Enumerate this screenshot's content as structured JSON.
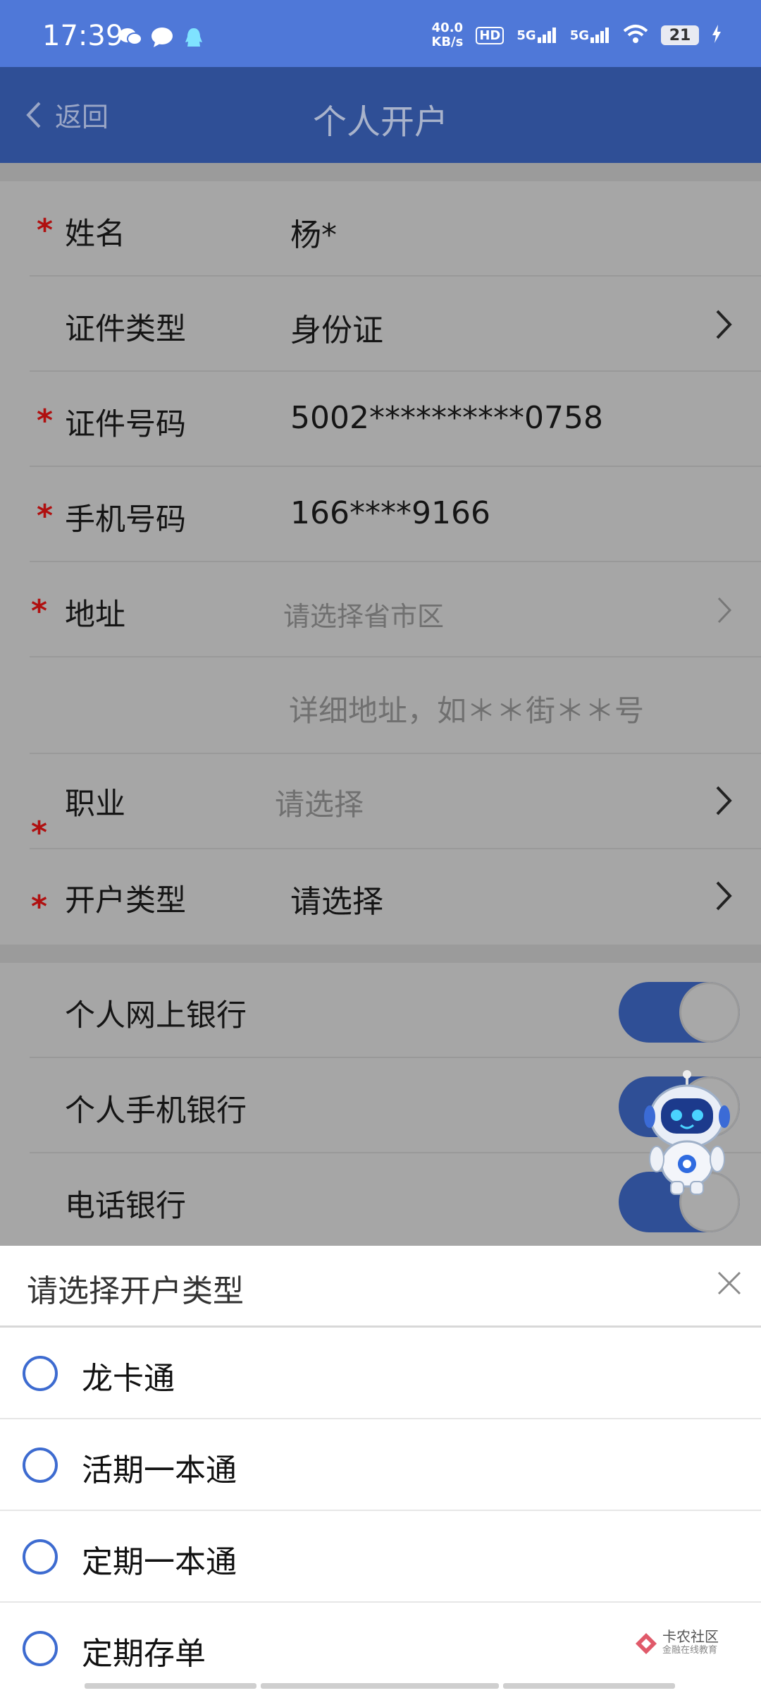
{
  "status_bar": {
    "time": "17:39",
    "network_speed_top": "40.0",
    "network_speed_unit": "KB/s",
    "hd_label": "HD",
    "signal1": "5G",
    "signal2": "5G",
    "battery": "21",
    "icons": [
      "wechat-icon",
      "message-icon",
      "qq-icon",
      "wifi-icon",
      "charging-icon"
    ]
  },
  "header": {
    "back_label": "返回",
    "title": "个人开户"
  },
  "form": {
    "name": {
      "label": "姓名",
      "value": "杨*",
      "required": true
    },
    "id_type": {
      "label": "证件类型",
      "value": "身份证"
    },
    "id_number": {
      "label": "证件号码",
      "value": "5002**********0758",
      "required": true
    },
    "phone": {
      "label": "手机号码",
      "value": "166****9166",
      "required": true
    },
    "address": {
      "label": "地址",
      "placeholder": "请选择省市区",
      "required": true
    },
    "address_detail": {
      "placeholder": "详细地址，如＊＊街＊＊号"
    },
    "occupation": {
      "label": "职业",
      "placeholder": "请选择",
      "required": true
    },
    "account_type": {
      "label": "开户类型",
      "value": "请选择",
      "required": true
    },
    "required_mark": "*"
  },
  "services": [
    {
      "label": "个人网上银行",
      "enabled": true
    },
    {
      "label": "个人手机银行",
      "enabled": true
    },
    {
      "label": "电话银行",
      "enabled": true
    }
  ],
  "sheet": {
    "title": "请选择开户类型",
    "options": [
      "龙卡通",
      "活期一本通",
      "定期一本通",
      "定期存单"
    ]
  },
  "watermark": {
    "line1": "卡农社区",
    "line2": "金融在线教育"
  },
  "colors": {
    "status_bar": "#4f78d8",
    "header": "#2f4f96",
    "required": "#b01010",
    "radio": "#3d6bd0"
  }
}
